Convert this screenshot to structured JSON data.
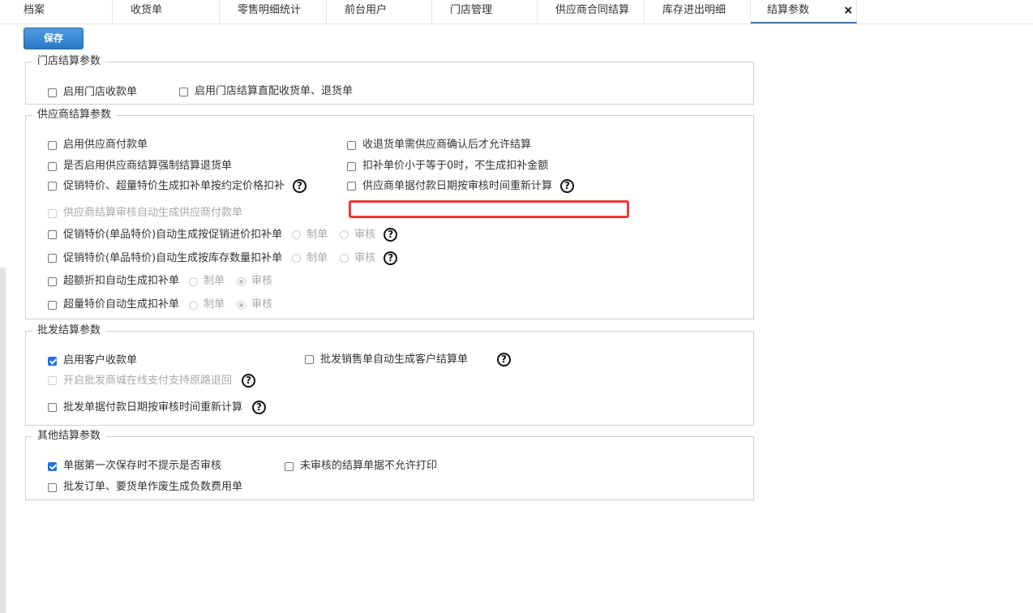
{
  "tabs": [
    {
      "label": "档案"
    },
    {
      "label": "收货单"
    },
    {
      "label": "零售明细统计"
    },
    {
      "label": "前台用户"
    },
    {
      "label": "门店管理"
    },
    {
      "label": "供应商合同结算"
    },
    {
      "label": "库存进出明细"
    },
    {
      "label": "结算参数",
      "active": true
    }
  ],
  "close_glyph": "×",
  "toolbar": {
    "save_label": "保存"
  },
  "help_glyph": "?",
  "store_group": {
    "title": "门店结算参数",
    "items": [
      {
        "label": "启用门店收款单",
        "checked": false
      },
      {
        "label": "启用门店结算直配收货单、退货单",
        "checked": false
      }
    ]
  },
  "supplier_group": {
    "title": "供应商结算参数",
    "items": {
      "enable_payment": {
        "label": "启用供应商付款单",
        "checked": false
      },
      "confirm_required": {
        "label": "收退货单需供应商确认后才允许结算",
        "checked": false
      },
      "force_return": {
        "label": "是否启用供应商结算强制结算退货单",
        "checked": false
      },
      "no_compensation": {
        "label": "扣补单价小于等于0时，不生成扣补金额",
        "checked": false
      },
      "promo_contract": {
        "label": "促销特价、超量特价生成扣补单按约定价格扣补",
        "checked": false
      },
      "recalc_date": {
        "label": "供应商单据付款日期按审核时间重新计算",
        "checked": false
      },
      "auto_payment": {
        "label": "供应商结算审核自动生成供应商付款单",
        "checked": false,
        "disabled": true
      },
      "promo_single_purchase": {
        "label": "促销特价(单品特价)自动生成按促销进价扣补单",
        "checked": false
      },
      "promo_single_stock": {
        "label": "促销特价(单品特价)自动生成按库存数量扣补单",
        "checked": false
      },
      "excess_discount": {
        "label": "超额折扣自动生成扣补单",
        "checked": false
      },
      "excess_special": {
        "label": "超量特价自动生成扣补单",
        "checked": false
      }
    },
    "radio_draft": "制单",
    "radio_audit": "审核"
  },
  "wholesale_group": {
    "title": "批发结算参数",
    "items": {
      "customer_receipt": {
        "label": "启用客户收款单",
        "checked": true
      },
      "auto_customer_settle": {
        "label": "批发销售单自动生成客户结算单",
        "checked": false
      },
      "online_refund": {
        "label": "开启批发商城在线支付支持原路退回",
        "checked": false,
        "disabled": true
      },
      "recalc_date": {
        "label": "批发单据付款日期按审核时间重新计算",
        "checked": false
      }
    }
  },
  "other_group": {
    "title": "其他结算参数",
    "items": {
      "no_prompt_audit": {
        "label": "单据第一次保存时不提示是否审核",
        "checked": true
      },
      "no_print_unaudited": {
        "label": "未审核的结算单据不允许打印",
        "checked": false
      },
      "void_negative_fee": {
        "label": "批发订单、要货单作废生成负数费用单",
        "checked": false
      }
    }
  },
  "colors": {
    "accent": "#2a7ac7",
    "highlight": "#e53935",
    "checkbox_checked": "#1a73e8"
  }
}
